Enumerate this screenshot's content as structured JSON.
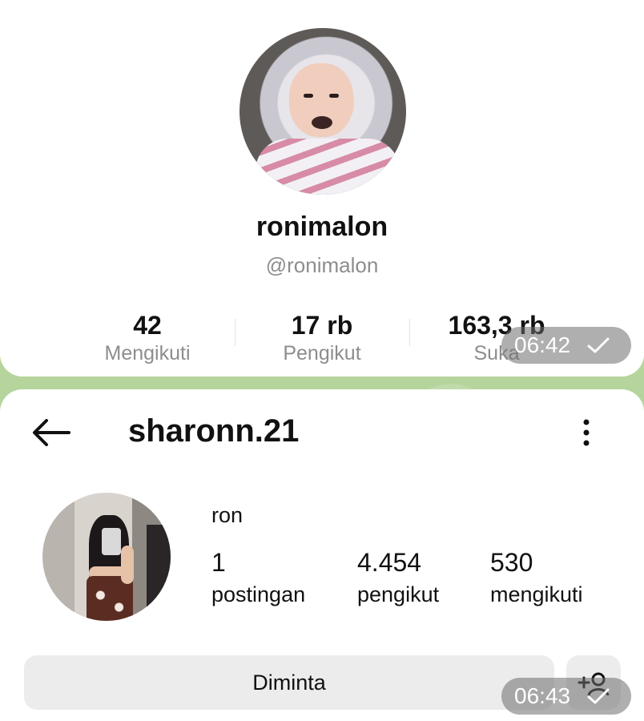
{
  "post1": {
    "display_name": "ronimalon",
    "handle": "@ronimalon",
    "stats": [
      {
        "value": "42",
        "label": "Mengikuti"
      },
      {
        "value": "17 rb",
        "label": "Pengikut"
      },
      {
        "value": "163,3 rb",
        "label": "Suka"
      }
    ],
    "time": "06:42"
  },
  "post2": {
    "username": "sharonn.21",
    "name": "ron",
    "stats": [
      {
        "value": "1",
        "label": "postingan"
      },
      {
        "value": "4.454",
        "label": "pengikut"
      },
      {
        "value": "530",
        "label": "mengikuti"
      }
    ],
    "request_button": "Diminta",
    "time": "06:43"
  }
}
